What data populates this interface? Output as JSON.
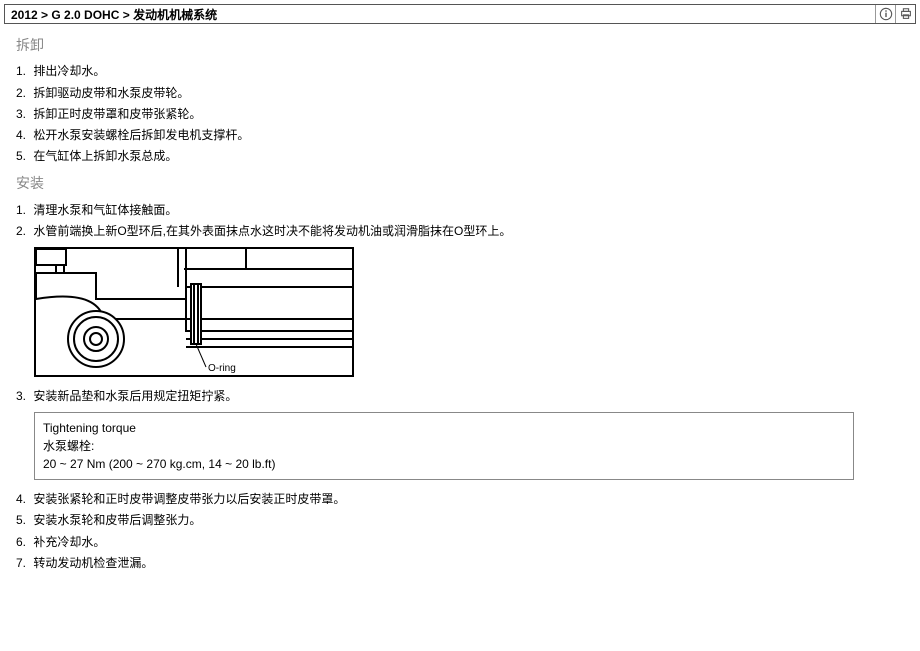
{
  "breadcrumb": "2012 > G 2.0 DOHC > 发动机机械系统",
  "icons": {
    "info": "info-icon",
    "print": "print-icon"
  },
  "removal": {
    "title": "拆卸",
    "steps": [
      "排出冷却水。",
      "拆卸驱动皮带和水泵皮带轮。",
      "拆卸正时皮带罩和皮带张紧轮。",
      "松开水泵安装螺栓后拆卸发电机支撑杆。",
      "在气缸体上拆卸水泵总成。"
    ]
  },
  "install": {
    "title": "安装",
    "steps_a": [
      "清理水泵和气缸体接触面。",
      "水管前端换上新O型环后,在其外表面抹点水这时决不能将发动机油或润滑脂抹在O型环上。"
    ],
    "figure_label": "O-ring",
    "steps_b_first": "安装新品垫和水泵后用规定扭矩拧紧。",
    "torque": {
      "title": "Tightening torque",
      "label": "水泵螺栓:",
      "value": "20 ~ 27 Nm (200 ~ 270 kg.cm, 14 ~ 20 lb.ft)"
    },
    "steps_c": [
      "安装张紧轮和正时皮带调整皮带张力以后安装正时皮带罩。",
      "安装水泵轮和皮带后调整张力。",
      "补充冷却水。",
      "转动发动机检查泄漏。"
    ]
  }
}
